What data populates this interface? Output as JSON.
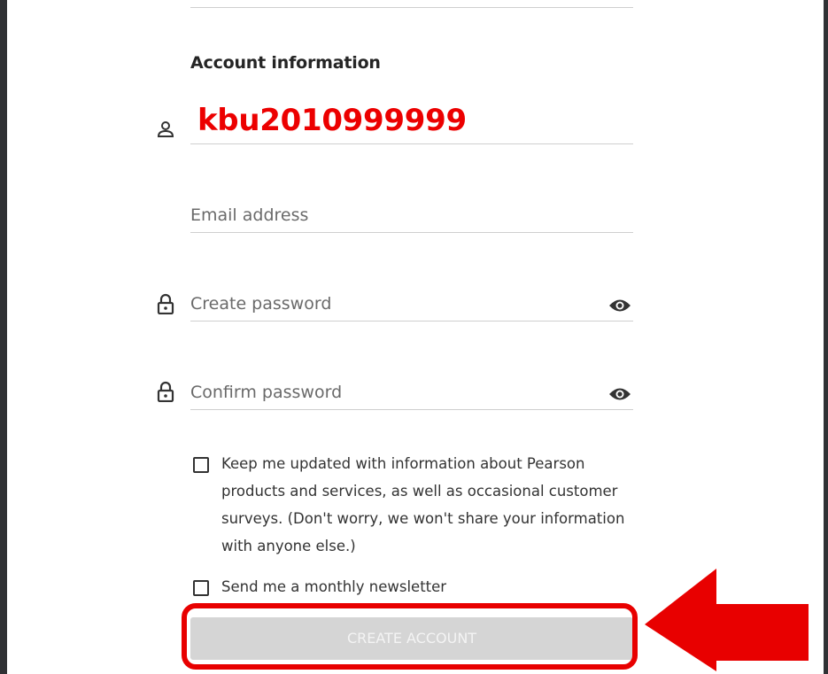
{
  "form": {
    "section_title": "Account information",
    "username_value": "kbu2010999999",
    "email_placeholder": "Email address",
    "create_password_placeholder": "Create password",
    "confirm_password_placeholder": "Confirm password",
    "updates_label": "Keep me updated with information about Pearson products and services, as well as occasional customer surveys. (Don't worry, we won't share your information with anyone else.)",
    "newsletter_label": "Send me a monthly newsletter",
    "create_button_label": "CREATE ACCOUNT"
  },
  "icons": {
    "username": "person-icon",
    "password": "lock-icon",
    "show_password": "eye-icon",
    "annotation": "arrow-left-icon"
  },
  "colors": {
    "annotation_red": "#e80000",
    "username_red": "#ec0000",
    "disabled_button": "#d5d5d5"
  }
}
